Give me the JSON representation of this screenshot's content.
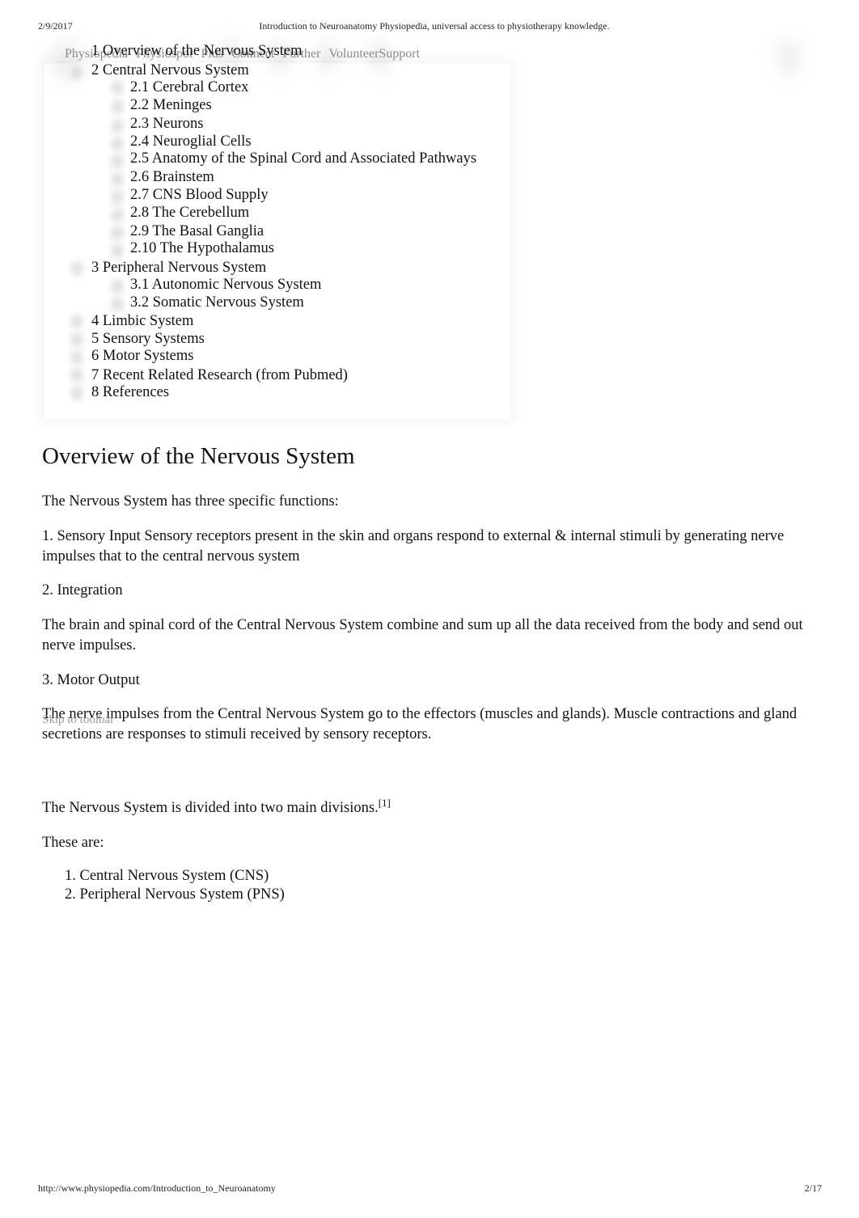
{
  "print_header": {
    "date": "2/9/2017",
    "title": "Introduction to Neuroanatomy  Physiopedia, universal access to physiotherapy knowledge."
  },
  "nav": {
    "items": [
      {
        "label": "Physiopedia"
      },
      {
        "label": "Physiospot"
      },
      {
        "label": "Plus"
      },
      {
        "label": "Connect"
      },
      {
        "label": "Further"
      },
      {
        "label": "Volunteer"
      },
      {
        "label": "Support"
      }
    ]
  },
  "toc": {
    "items": [
      {
        "label": "1 Overview of the Nervous System",
        "level": 1
      },
      {
        "label": "2 Central Nervous System",
        "level": 1
      },
      {
        "label": "2.1 Cerebral Cortex",
        "level": 2
      },
      {
        "label": "2.2 Meninges",
        "level": 2
      },
      {
        "label": "2.3 Neurons",
        "level": 2
      },
      {
        "label": "2.4 Neuroglial Cells",
        "level": 2
      },
      {
        "label": "2.5 Anatomy of the Spinal Cord and Associated Pathways",
        "level": 2
      },
      {
        "label": "2.6 Brainstem",
        "level": 2
      },
      {
        "label": "2.7 CNS Blood Supply",
        "level": 2
      },
      {
        "label": "2.8 The Cerebellum",
        "level": 2
      },
      {
        "label": "2.9 The Basal Ganglia",
        "level": 2
      },
      {
        "label": "2.10 The Hypothalamus",
        "level": 2
      },
      {
        "label": "3 Peripheral Nervous System",
        "level": 1
      },
      {
        "label": "3.1 Autonomic Nervous System",
        "level": 2
      },
      {
        "label": "3.2 Somatic Nervous System",
        "level": 2
      },
      {
        "label": "4 Limbic System",
        "level": 1
      },
      {
        "label": "5 Sensory Systems",
        "level": 1
      },
      {
        "label": "6 Motor Systems",
        "level": 1
      },
      {
        "label": "7 Recent Related Research (from Pubmed)",
        "level": 1
      },
      {
        "label": "8 References",
        "level": 1
      }
    ]
  },
  "article": {
    "heading": "Overview of the Nervous System",
    "paragraphs": [
      "The Nervous System has three specific functions:",
      "1. Sensory Input   Sensory receptors present in the skin and organs respond to external & internal stimuli by generating nerve impulses that to the central nervous system",
      "2. Integration",
      "The brain and spinal cord of the Central Nervous System combine and sum up all the data received from the body and send out nerve impulses.",
      "3. Motor Output",
      "The nerve impulses from the Central Nervous System go to the effectors (muscles and glands). Muscle contractions and gland secretions are responses to stimuli received by sensory receptors.",
      "The Nervous System is divided into two main divisions.",
      "These are:"
    ],
    "citation": "[1]",
    "divisions": [
      "1. Central Nervous System (CNS)",
      "2. Peripheral Nervous System (PNS)"
    ]
  },
  "skip_toolbar": "Skip to toolbar",
  "print_footer": {
    "url": "http://www.physiopedia.com/Introduction_to_Neuroanatomy",
    "page": "2/17"
  }
}
